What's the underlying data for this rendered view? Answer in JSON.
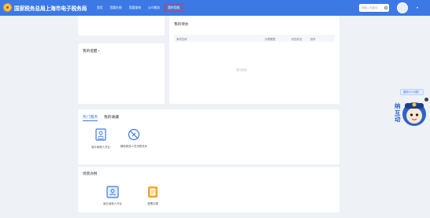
{
  "header": {
    "title": "国家税务总局上海市电子税务局",
    "nav": [
      "首页",
      "我要办税",
      "我要查询",
      "公众服务",
      "我的导航"
    ],
    "active_nav_index": 4,
    "search_placeholder": "请输入关键词",
    "brand_color": "#3c79e4"
  },
  "todo": {
    "title": "我的待办",
    "columns": [
      "事项名称",
      "办理期限",
      "状态状态",
      "操作"
    ],
    "empty_text": "暂无数据"
  },
  "reminders": {
    "title": "我的提醒 ›"
  },
  "tabs": [
    "热门服务",
    "我的收藏"
  ],
  "active_tab_index": 0,
  "hot_services": [
    {
      "label": "新办纳税人开业",
      "icon": "id-card-icon"
    },
    {
      "label": "解除税务人员关联关系",
      "icon": "unlink-icon"
    }
  ],
  "quick": {
    "title": "场景办税",
    "items": [
      {
        "label": "新办纳税人开业",
        "icon": "id-card-icon"
      },
      {
        "label": "首票办理",
        "icon": "document-icon"
      }
    ]
  },
  "assistant": {
    "badge": "遇到什么问题？",
    "mascot_text": "纳互动"
  }
}
